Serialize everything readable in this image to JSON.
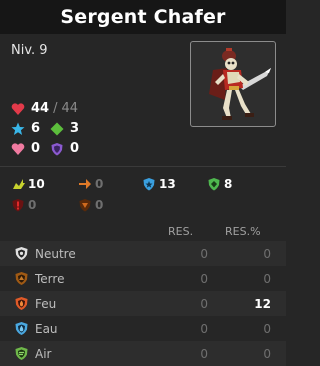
{
  "header": {
    "title": "Sergent Chafer"
  },
  "level": "Niv. 9",
  "portrait": {
    "icon": "skeleton-warrior-portrait"
  },
  "stats": {
    "hp_current": "44",
    "hp_sep": "/",
    "hp_max": "44",
    "ap": "6",
    "mp": "3",
    "heal": "0",
    "shield": "0"
  },
  "characteristics": {
    "row1": [
      {
        "icon": "power-icon",
        "value": "10",
        "color": "#c7d22e"
      },
      {
        "icon": "damage-icon",
        "value": "0",
        "color": "#e07a28"
      },
      {
        "icon": "initiative-icon",
        "value": "13",
        "color": "#3aa0e0"
      },
      {
        "icon": "crit-icon",
        "value": "8",
        "color": "#4fb84f"
      }
    ],
    "row2": [
      {
        "icon": "erosion-icon",
        "value": "0",
        "color": "#b01818"
      },
      {
        "icon": "pushback-icon",
        "value": "0",
        "color": "#c05a14"
      }
    ]
  },
  "resistances": {
    "col_res": "RES.",
    "col_res_pct": "RES.%",
    "rows": [
      {
        "name": "Neutre",
        "res": "0",
        "pct": "0",
        "color": "#e0e0e0"
      },
      {
        "name": "Terre",
        "res": "0",
        "pct": "0",
        "color": "#a05a14"
      },
      {
        "name": "Feu",
        "res": "0",
        "pct": "12",
        "color": "#e05a28"
      },
      {
        "name": "Eau",
        "res": "0",
        "pct": "0",
        "color": "#4aa8e0"
      },
      {
        "name": "Air",
        "res": "0",
        "pct": "0",
        "color": "#6fb84a"
      }
    ]
  }
}
